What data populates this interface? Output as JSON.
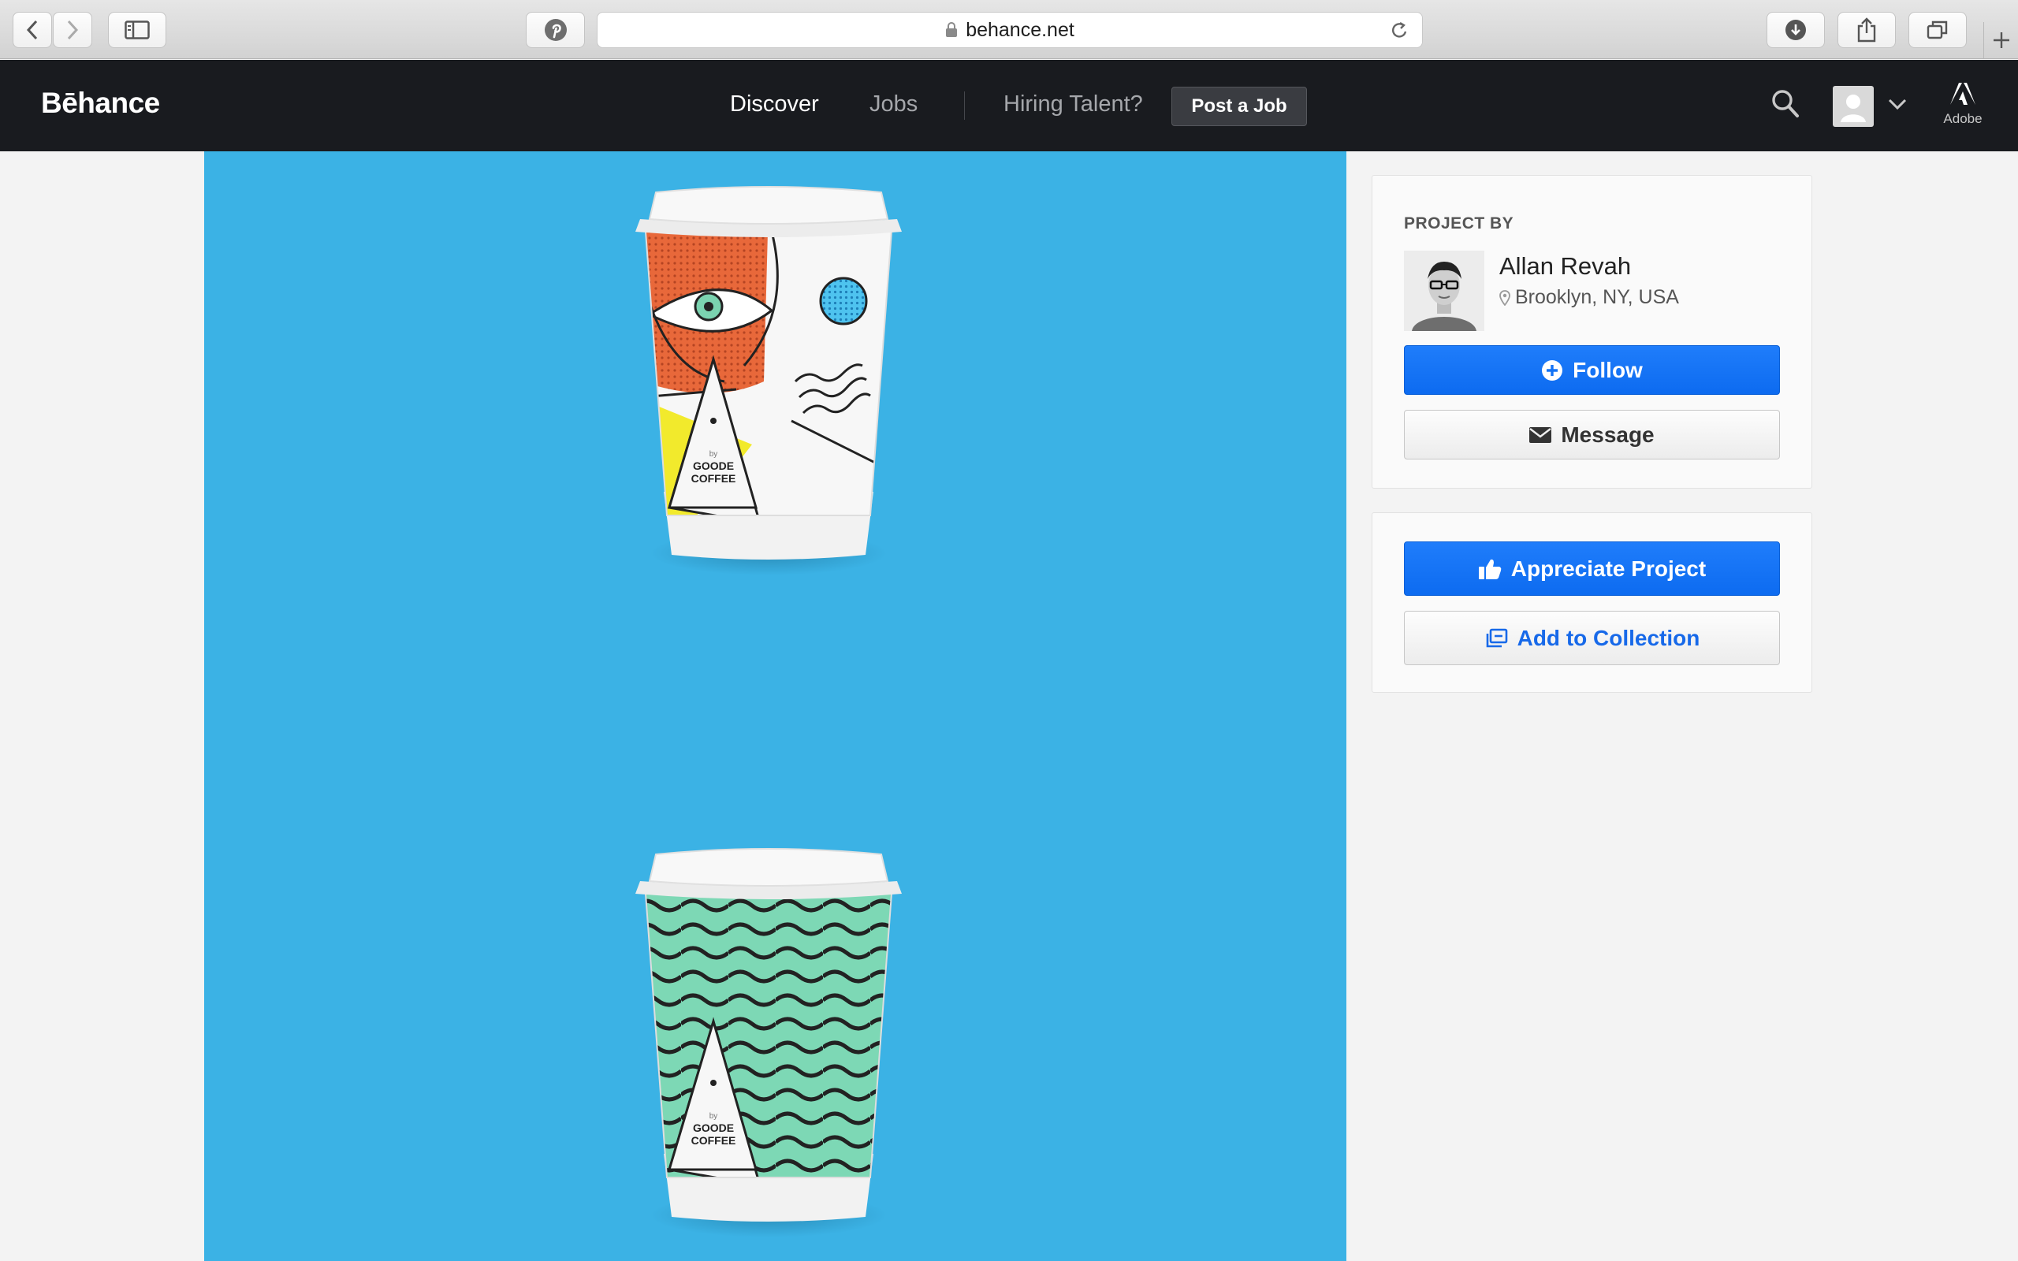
{
  "browser": {
    "url": "behance.net"
  },
  "nav": {
    "logo": "Bēhance",
    "links": [
      "Discover",
      "Jobs",
      "Hiring Talent?"
    ],
    "post_job": "Post a Job",
    "adobe_label": "Adobe"
  },
  "project_images": [
    {
      "brand_line1": "GOODE",
      "brand_line2": "COFFEE",
      "by": "by"
    },
    {
      "brand_line1": "GOODE",
      "brand_line2": "COFFEE",
      "by": "by"
    }
  ],
  "owner_card": {
    "heading": "PROJECT BY",
    "name": "Allan Revah",
    "location": "Brooklyn, NY, USA",
    "follow_label": "Follow",
    "message_label": "Message"
  },
  "actions_card": {
    "appreciate_label": "Appreciate Project",
    "collection_label": "Add to Collection"
  },
  "colors": {
    "project_bg": "#3bb2e5",
    "primary_blue": "#1473f5",
    "nav_bg": "#191b1f"
  }
}
